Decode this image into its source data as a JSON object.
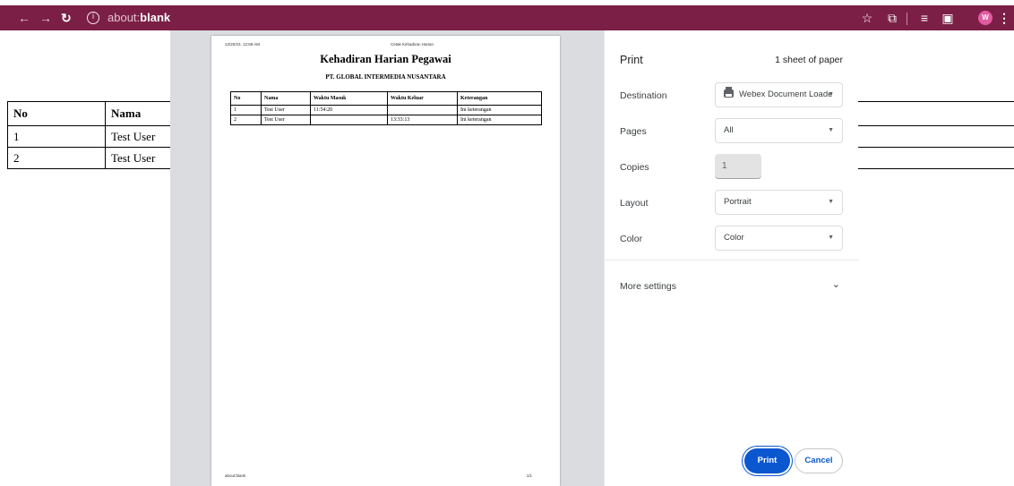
{
  "browser": {
    "url_scheme": "about:",
    "url_host": "blank",
    "avatar_letter": "W",
    "accent": "#7b1f46"
  },
  "background_page": {
    "headers": [
      "No",
      "Nama"
    ],
    "rows": [
      [
        "1",
        "Test User"
      ],
      [
        "2",
        "Test User"
      ]
    ]
  },
  "preview": {
    "header_date": "12/20/23, 12:58 AM",
    "header_title": "Cetak Kehadiran Harian",
    "title": "Kehadiran Harian Pegawai",
    "subtitle": "PT. GLOBAL INTERMEDIA NUSANTARA",
    "table_headers": [
      "No",
      "Nama",
      "Waktu Masuk",
      "Waktu Keluar",
      "Keterangan"
    ],
    "table_rows": [
      [
        "1",
        "Test User",
        "11:54:20",
        "",
        "Ini keterangan"
      ],
      [
        "2",
        "Test User",
        "",
        "13:33:13",
        "Ini keterangan"
      ]
    ],
    "footer_left": "about:blank",
    "footer_right": "1/1"
  },
  "print_panel": {
    "title": "Print",
    "sheets": "1 sheet of paper",
    "destination_label": "Destination",
    "destination_value": "Webex Document Loade",
    "pages_label": "Pages",
    "pages_value": "All",
    "copies_label": "Copies",
    "copies_value": "1",
    "layout_label": "Layout",
    "layout_value": "Portrait",
    "color_label": "Color",
    "color_value": "Color",
    "more_settings": "More settings",
    "print_button": "Print",
    "cancel_button": "Cancel",
    "primary_color": "#0b57d0"
  }
}
